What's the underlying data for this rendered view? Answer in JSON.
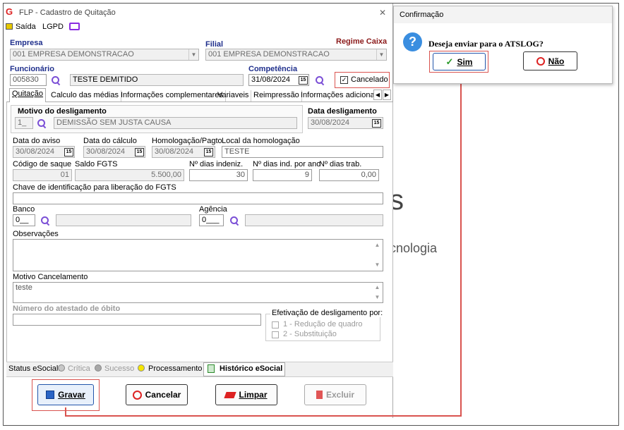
{
  "window": {
    "title": "FLP - Cadastro de Quitação",
    "close": "✕",
    "menu": {
      "exit": "Saída",
      "lgpd": "LGPD"
    }
  },
  "header": {
    "regime": "Regime Caixa",
    "empresa_label": "Empresa",
    "empresa_value": "001 EMPRESA DEMONSTRACAO",
    "filial_label": "Filial",
    "filial_value": "001 EMPRESA DEMONSTRACAO",
    "funcionario_label": "Funcionário",
    "funcionario_code": "005830",
    "funcionario_name": "TESTE DEMITIDO",
    "competencia_label": "Competência",
    "competencia_value": "31/08/2024",
    "cancelado_label": "Cancelado",
    "cancelado_checked": true
  },
  "tabs": [
    {
      "label": "Quitação",
      "active": true
    },
    {
      "label": "Calculo das médias",
      "active": false
    },
    {
      "label": "Informações complementares",
      "active": false
    },
    {
      "label": "Variaveis",
      "active": false
    },
    {
      "label": "Reimpressão",
      "active": false
    },
    {
      "label": "Informações adicionais",
      "active": false
    }
  ],
  "form": {
    "motivo_label": "Motivo do desligamento",
    "motivo_code": "1_",
    "motivo_desc": "DEMISSÃO SEM JUSTA CAUSA",
    "data_deslig_label": "Data desligamento",
    "data_deslig_value": "30/08/2024",
    "data_aviso_label": "Data do aviso",
    "data_aviso_value": "30/08/2024",
    "data_calculo_label": "Data do cálculo",
    "data_calculo_value": "30/08/2024",
    "homolog_label": "Homologação/Pagto",
    "homolog_value": "30/08/2024",
    "local_label": "Local da homologação",
    "local_value": "TESTE",
    "cod_saque_label": "Código de saque",
    "cod_saque_value": "01",
    "saldo_label": "Saldo FGTS",
    "saldo_value": "5.500,00",
    "dias_indeniz_label": "Nº dias indeniz.",
    "dias_indeniz_value": "30",
    "dias_ind_ano_label": "Nº dias ind. por ano",
    "dias_ind_ano_value": "9",
    "dias_trab_label": "Nº dias trab.",
    "dias_trab_value": "0,00",
    "chave_label": "Chave de identificação para liberação do FGTS",
    "chave_value": "",
    "banco_label": "Banco",
    "banco_code": "0__",
    "agencia_label": "Agência",
    "agencia_code": "0___",
    "obs_label": "Observações",
    "motivo_canc_label": "Motivo Cancelamento",
    "motivo_canc_value": "teste",
    "atestado_label": "Número do atestado de óbito",
    "efetivacao_label": "Efetivação de desligamento por:",
    "efet_opt1": "1 - Redução de quadro",
    "efet_opt2": "2 - Substituição"
  },
  "status": {
    "label": "Status eSocial:",
    "critica": "Crítica",
    "sucesso": "Sucesso",
    "processamento": "Processamento",
    "historico": "Histórico eSocial",
    "colors": {
      "critica": "#c8c8c8",
      "sucesso": "#a8a8a8",
      "processamento": "#f5e600"
    }
  },
  "buttons": {
    "gravar": "Gravar",
    "cancelar": "Cancelar",
    "limpar": "Limpar",
    "excluir": "Excluir"
  },
  "dialog": {
    "title": "Confirmação",
    "message": "Deseja enviar para o ATSLOG?",
    "yes": "Sim",
    "no": "Não"
  },
  "background_text": {
    "s_char": "s",
    "tecnologia": "cnologia"
  },
  "colors": {
    "highlight": "#d9534f",
    "label_blue": "#1f2f8c",
    "regime": "#8b1a1a",
    "accent_purple": "#7b4fd6"
  }
}
